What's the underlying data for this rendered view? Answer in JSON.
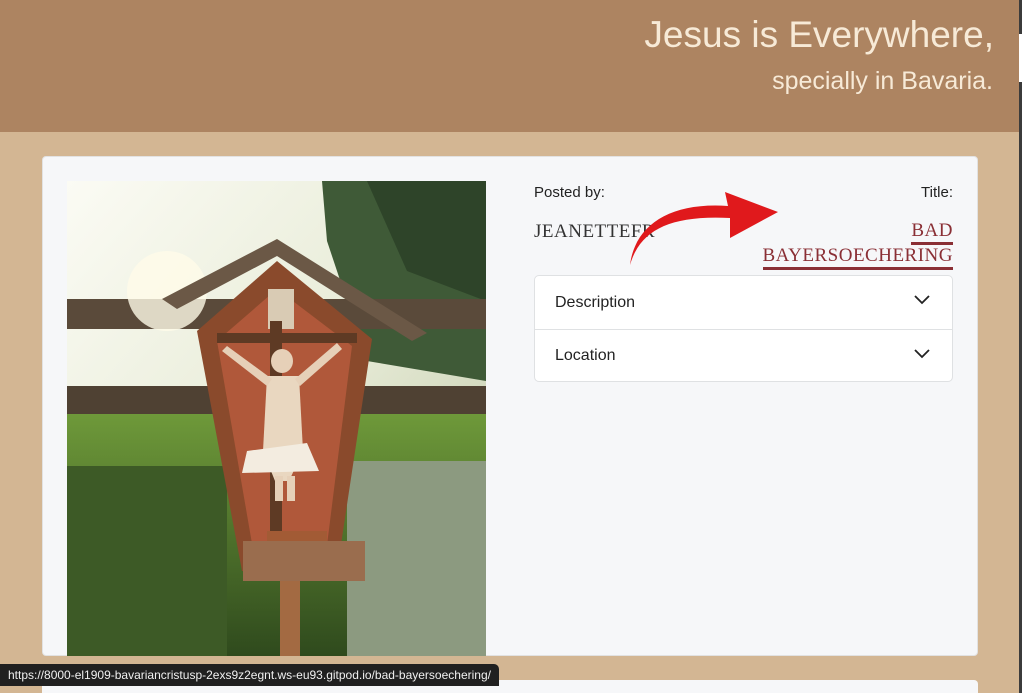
{
  "hero": {
    "title": "Jesus is Everywhere,",
    "subtitle": "specially in Bavaria."
  },
  "post": {
    "posted_by_label": "Posted by:",
    "title_label": "Title:",
    "poster": "JEANETTEFR",
    "title_line1": "BAD",
    "title_line2": "BAYERSOECHERING",
    "image_icon": "wayside-crucifix-shrine-photo"
  },
  "accordion": [
    {
      "label": "Description",
      "icon": "chevron-down-icon"
    },
    {
      "label": "Location",
      "icon": "chevron-down-icon"
    }
  ],
  "status_url": "https://8000-el1909-bavariancristusp-2exs9z2egnt.ws-eu93.gitpod.io/bad-bayersoechering/",
  "colors": {
    "hero_bg": "#ad8461",
    "page_bg": "#d3b693",
    "accent_title": "#8a2f35",
    "arrow": "#e0191c"
  }
}
